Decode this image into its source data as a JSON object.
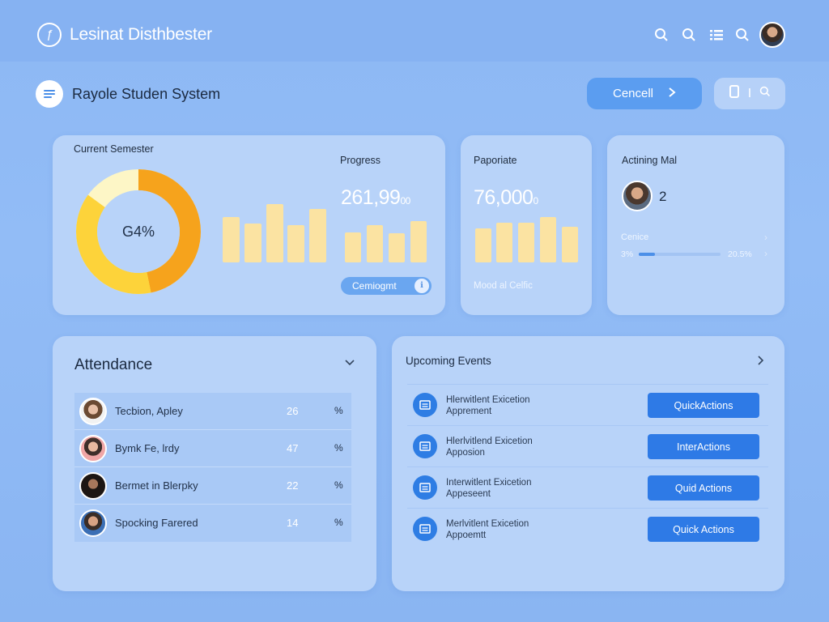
{
  "app": {
    "title": "Lesinat Disthbester",
    "logo_icon": "leaf-icon"
  },
  "top_icons": [
    "search-icon",
    "search-icon",
    "list-icon",
    "search-icon"
  ],
  "header": {
    "title": "Rayole Studen System",
    "cancel_label": "Cencell",
    "ghost_label": "I"
  },
  "semester_card": {
    "label": "Current Semester",
    "center_value": "G4%",
    "ring_percent": 0.85,
    "progress_label": "Progress",
    "progress_value": "261,99",
    "progress_suffix": "00",
    "pill_label": "Cemiogmt",
    "pill_icon": "info-icon"
  },
  "paporiate_card": {
    "label": "Paporiate",
    "value": "76,000",
    "suffix": "0",
    "footer": "Mood al Celfic"
  },
  "actining_card": {
    "label": "Actining Mal",
    "count": "2",
    "sub_label": "Cenice",
    "left_value": "3%",
    "right_value": "20.5%",
    "progress_fraction": 0.2
  },
  "attendance": {
    "title": "Attendance",
    "rows": [
      {
        "name": "Tecbion, Apley",
        "count": "26",
        "unit": "%"
      },
      {
        "name": "Bymk Fe, lrdy",
        "count": "47",
        "unit": "%"
      },
      {
        "name": "Bermet in Blerpky",
        "count": "22",
        "unit": "%"
      },
      {
        "name": "Spocking Farered",
        "count": "14",
        "unit": "%"
      }
    ]
  },
  "events": {
    "title": "Upcoming Events",
    "rows": [
      {
        "line1": "Hlerwitlent Exicetion",
        "line2": "Apprement",
        "button": "QuickActions"
      },
      {
        "line1": "Hlerlvitlend Exicetion",
        "line2": "Apposion",
        "button": "InterActions"
      },
      {
        "line1": "Interwitlent Exicetion",
        "line2": "Appeseent",
        "button": "Quid Actions"
      },
      {
        "line1": "Merlvitlent Exicetion",
        "line2": "Appoemtt",
        "button": "Quick Actions"
      }
    ]
  },
  "colors": {
    "accent": "#2e7ae6",
    "donut_orange": "#f6a31c",
    "donut_yellow": "#fdd33a",
    "donut_cream": "#fdf6c6",
    "bar": "#fbe3a2"
  }
}
